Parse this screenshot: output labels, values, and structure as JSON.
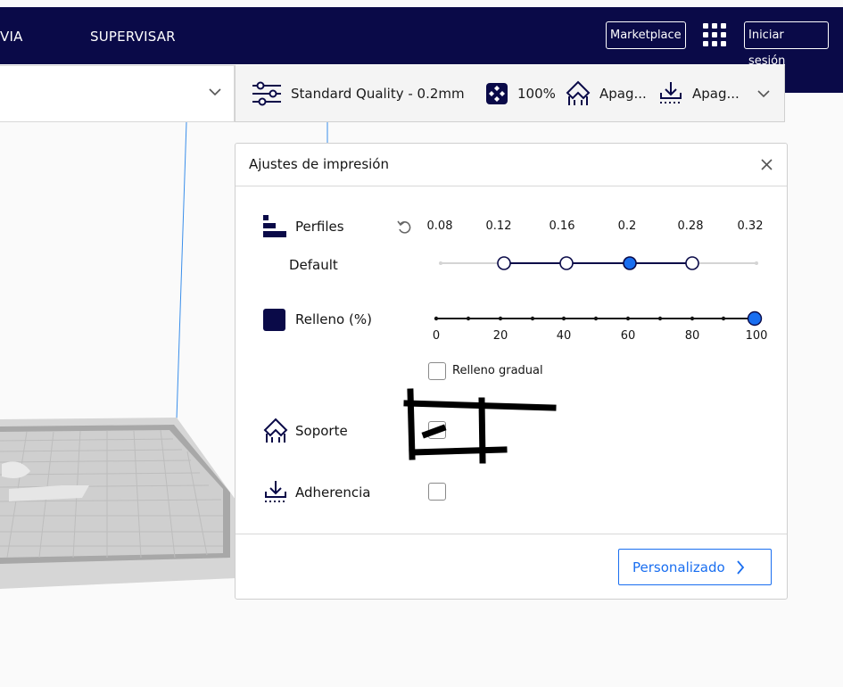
{
  "nav": {
    "prepare": "VIA",
    "monitor": "SUPERVISAR"
  },
  "header_buttons": {
    "marketplace": "Marketplace",
    "signin": "Iniciar sesión"
  },
  "print_setup": {
    "profile": "Standard Quality - 0.2mm",
    "infill": "100%",
    "support": "Apag...",
    "adhesion": "Apag..."
  },
  "panel": {
    "title": "Ajustes de impresión",
    "profiles_label": "Perfiles",
    "profile_name": "Default",
    "layer_heights": [
      "0.08",
      "0.12",
      "0.16",
      "0.2",
      "0.28",
      "0.32"
    ],
    "selected_layer_height": "0.2",
    "infill_label": "Relleno (%)",
    "infill_ticks": [
      "0",
      "20",
      "40",
      "60",
      "80",
      "100"
    ],
    "infill_value": 100,
    "gradual_infill_label": "Relleno gradual",
    "support_label": "Soporte",
    "adhesion_label": "Adherencia",
    "custom_button": "Personalizado"
  },
  "colors": {
    "brand_dark": "#0a0a48",
    "accent": "#196ef0"
  },
  "icons": [
    "apps-grid-icon",
    "chevron-down-icon",
    "sliders-icon",
    "infill-icon",
    "support-icon",
    "adhesion-icon",
    "profiles-icon",
    "reset-icon",
    "close-icon",
    "chevron-right-icon"
  ]
}
